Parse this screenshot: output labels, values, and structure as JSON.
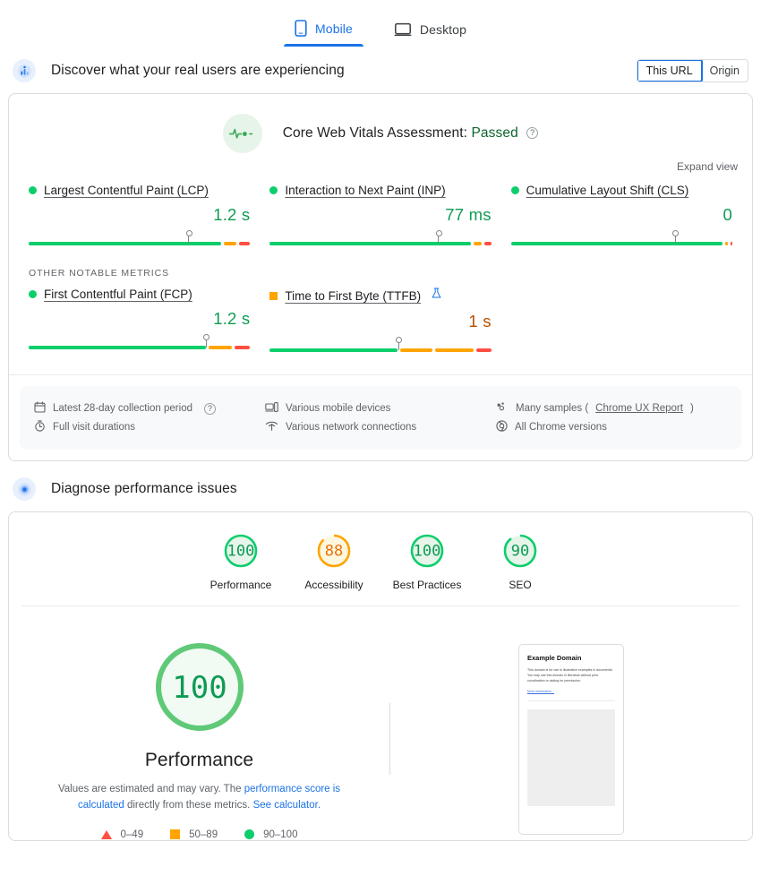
{
  "tabs": [
    {
      "label": "Mobile",
      "icon": "mobile-icon",
      "active": true
    },
    {
      "label": "Desktop",
      "icon": "desktop-icon",
      "active": false
    }
  ],
  "field_section": {
    "icon": "crux-bars-icon",
    "title": "Discover what your real users are experiencing",
    "scope_toggle": {
      "selected": "This URL",
      "options": [
        "This URL",
        "Origin"
      ]
    },
    "assessment": {
      "icon": "pulse-icon",
      "label": "Core Web Vitals Assessment:",
      "status": "Passed",
      "help_icon": "question-mark-icon"
    },
    "expand_view": "Expand view",
    "core_metrics": [
      {
        "name": "Largest Contentful Paint (LCP)",
        "value": "1.2 s",
        "rating": "good",
        "marker_pct": 72,
        "distribution": [
          {
            "rating": "good",
            "pct": 89
          },
          {
            "rating": "needs-improvement",
            "pct": 6
          },
          {
            "rating": "poor",
            "pct": 5
          }
        ]
      },
      {
        "name": "Interaction to Next Paint (INP)",
        "value": "77 ms",
        "rating": "good",
        "marker_pct": 76,
        "distribution": [
          {
            "rating": "good",
            "pct": 93
          },
          {
            "rating": "needs-improvement",
            "pct": 4
          },
          {
            "rating": "poor",
            "pct": 3
          }
        ]
      },
      {
        "name": "Cumulative Layout Shift (CLS)",
        "value": "0",
        "rating": "good",
        "marker_pct": 74,
        "distribution": [
          {
            "rating": "good",
            "pct": 98
          },
          {
            "rating": "needs-improvement",
            "pct": 1
          },
          {
            "rating": "poor",
            "pct": 1
          }
        ]
      }
    ],
    "other_metrics_heading": "OTHER NOTABLE METRICS",
    "other_metrics": [
      {
        "name": "First Contentful Paint (FCP)",
        "value": "1.2 s",
        "rating": "good",
        "marker_pct": 80,
        "distribution": [
          {
            "rating": "good",
            "pct": 82
          },
          {
            "rating": "needs-improvement",
            "pct": 11
          },
          {
            "rating": "poor",
            "pct": 7
          }
        ]
      },
      {
        "name": "Time to First Byte (TTFB)",
        "value": "1 s",
        "rating": "needs-improvement",
        "experimental_icon": "flask-icon",
        "marker_pct": 58,
        "distribution": [
          {
            "rating": "good",
            "pct": 60
          },
          {
            "rating": "needs-improvement",
            "pct": 15
          },
          {
            "rating": "needs-improvement",
            "pct": 18
          },
          {
            "rating": "poor",
            "pct": 7
          }
        ]
      }
    ],
    "meta": [
      [
        {
          "icon": "calendar-icon",
          "text": "Latest 28-day collection period",
          "help_icon": "question-mark-icon"
        },
        {
          "icon": "stopwatch-icon",
          "text": "Full visit durations"
        }
      ],
      [
        {
          "icon": "devices-icon",
          "text": "Various mobile devices"
        },
        {
          "icon": "wifi-icon",
          "text": "Various network connections"
        }
      ],
      [
        {
          "icon": "samples-icon",
          "text": "Many samples (",
          "link": "Chrome UX Report",
          "text_after": ")"
        },
        {
          "icon": "chrome-icon",
          "text": "All Chrome versions"
        }
      ]
    ]
  },
  "lab_section": {
    "icon": "diagnose-icon",
    "title": "Diagnose performance issues",
    "category_scores": [
      {
        "label": "Performance",
        "score": "100",
        "rating": "good"
      },
      {
        "label": "Accessibility",
        "score": "88",
        "rating": "needs-improvement"
      },
      {
        "label": "Best Practices",
        "score": "100",
        "rating": "good"
      },
      {
        "label": "SEO",
        "score": "90",
        "rating": "good"
      }
    ],
    "featured": {
      "score": "100",
      "label": "Performance",
      "note_before": "Values are estimated and may vary. The ",
      "note_link1": "performance score is calculated",
      "note_middle": " directly from these metrics. ",
      "note_link2": "See calculator."
    },
    "legend": [
      {
        "shape": "triangle",
        "range": "0–49",
        "color": "#ff4e42"
      },
      {
        "shape": "square",
        "range": "50–89",
        "color": "#ffa400"
      },
      {
        "shape": "circle",
        "range": "90–100",
        "color": "#0cce6b"
      }
    ],
    "thumbnail": {
      "heading": "Example Domain",
      "body": "This domain is for use in illustrative examples in documents. You may use this domain in literature without prior coordination or asking for permission.",
      "link": "More information..."
    }
  },
  "colors": {
    "good": "#0cce6b",
    "needs_improvement": "#ffa400",
    "poor": "#ff4e42",
    "accent": "#1a73e8",
    "pass_text": "#0d652d"
  }
}
